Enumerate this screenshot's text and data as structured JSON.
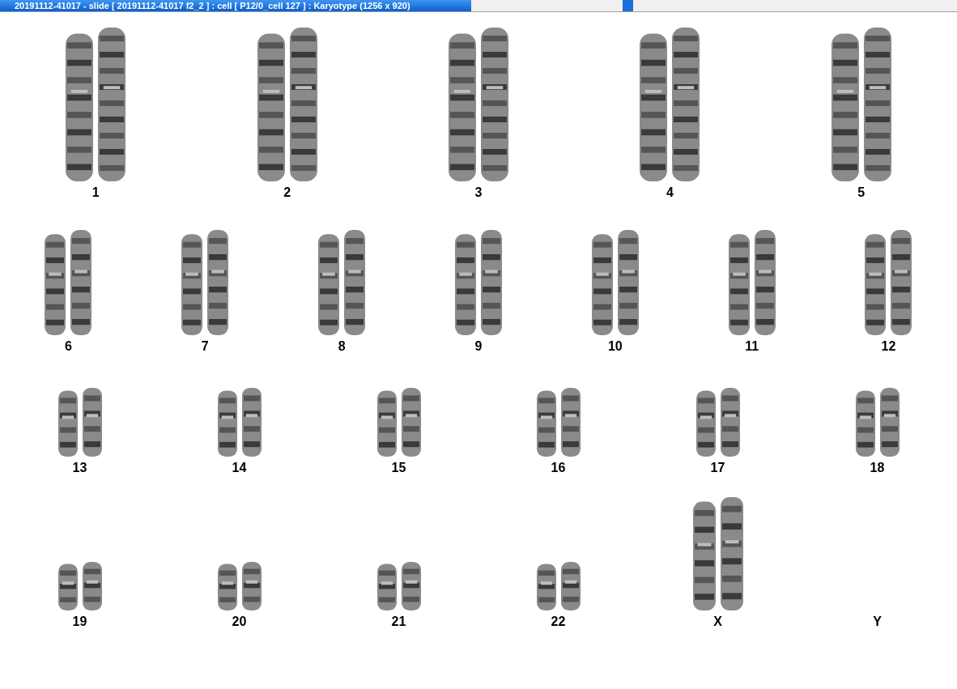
{
  "window": {
    "title": "20191112-41017 - slide [ 20191112-41017 f2_2 ] : cell [ P12/0_cell 127 ] : Karyotype  (1256 x 920)"
  },
  "karyotype_rows": [
    {
      "pairs": [
        {
          "label": "1",
          "kind": "pair"
        },
        {
          "label": "2",
          "kind": "pair"
        },
        {
          "label": "3",
          "kind": "pair"
        },
        {
          "label": "4",
          "kind": "pair"
        },
        {
          "label": "5",
          "kind": "pair"
        }
      ]
    },
    {
      "pairs": [
        {
          "label": "6",
          "kind": "pair"
        },
        {
          "label": "7",
          "kind": "pair"
        },
        {
          "label": "8",
          "kind": "pair"
        },
        {
          "label": "9",
          "kind": "pair"
        },
        {
          "label": "10",
          "kind": "pair"
        },
        {
          "label": "11",
          "kind": "pair"
        },
        {
          "label": "12",
          "kind": "pair"
        }
      ]
    },
    {
      "pairs": [
        {
          "label": "13",
          "kind": "pair"
        },
        {
          "label": "14",
          "kind": "pair"
        },
        {
          "label": "15",
          "kind": "pair"
        },
        {
          "label": "16",
          "kind": "pair"
        },
        {
          "label": "17",
          "kind": "pair"
        },
        {
          "label": "18",
          "kind": "pair"
        }
      ]
    },
    {
      "pairs": [
        {
          "label": "19",
          "kind": "pair"
        },
        {
          "label": "20",
          "kind": "pair"
        },
        {
          "label": "21",
          "kind": "pair"
        },
        {
          "label": "22",
          "kind": "pair"
        },
        {
          "label": "X",
          "kind": "pair"
        },
        {
          "label": "Y",
          "kind": "empty"
        }
      ]
    }
  ]
}
